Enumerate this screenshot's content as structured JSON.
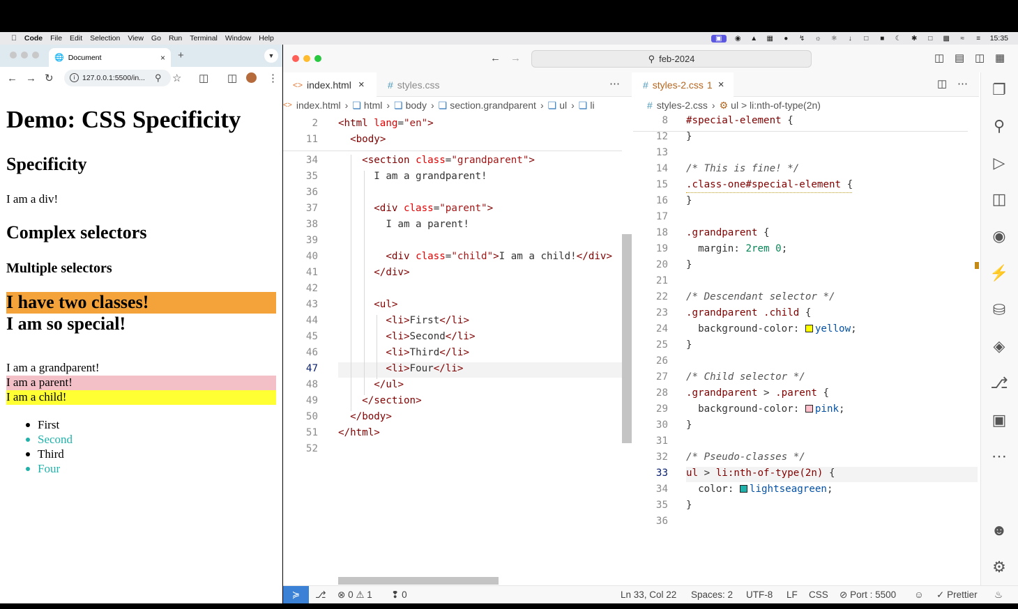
{
  "menubar": {
    "app": "Code",
    "items": [
      "File",
      "Edit",
      "Selection",
      "View",
      "Go",
      "Run",
      "Terminal",
      "Window",
      "Help"
    ],
    "clock": "15:35"
  },
  "browser": {
    "tab_title": "Document",
    "url": "127.0.0.1:5500/in...",
    "content": {
      "h1": "Demo: CSS Specificity",
      "h2_specificity": "Specificity",
      "div_text": "I am a div!",
      "h2_complex": "Complex selectors",
      "h3_multiple": "Multiple selectors",
      "two_classes": "I have two classes!",
      "special": "I am so special!",
      "grandparent": "I am a grandparent!",
      "parent": "I am a parent!",
      "child": "I am a child!",
      "list": [
        "First",
        "Second",
        "Third",
        "Four"
      ]
    },
    "colors": {
      "two_classes_bg": "#f4a23a",
      "parent_bg": "#f4c0c8",
      "child_bg": "#ffff33",
      "seagreen": "#20b2aa"
    }
  },
  "vscode": {
    "search": "feb-2024",
    "left_editor": {
      "tabs": [
        {
          "label": "index.html",
          "active": true
        },
        {
          "label": "styles.css",
          "active": false
        }
      ],
      "breadcrumb": [
        "index.html",
        "html",
        "body",
        "section.grandparent",
        "ul",
        "li"
      ],
      "sticky": [
        {
          "n": "2",
          "code": "<html lang=\"en\">"
        },
        {
          "n": "11",
          "code": "  <body>"
        }
      ],
      "lines": [
        {
          "n": "34",
          "code": "    <section class=\"grandparent\">"
        },
        {
          "n": "35",
          "code": "      I am a grandparent!"
        },
        {
          "n": "36",
          "code": ""
        },
        {
          "n": "37",
          "code": "      <div class=\"parent\">"
        },
        {
          "n": "38",
          "code": "        I am a parent!"
        },
        {
          "n": "39",
          "code": ""
        },
        {
          "n": "40",
          "code": "        <div class=\"child\">I am a child!</div>"
        },
        {
          "n": "41",
          "code": "      </div>"
        },
        {
          "n": "42",
          "code": ""
        },
        {
          "n": "43",
          "code": "      <ul>"
        },
        {
          "n": "44",
          "code": "        <li>First</li>"
        },
        {
          "n": "45",
          "code": "        <li>Second</li>"
        },
        {
          "n": "46",
          "code": "        <li>Third</li>"
        },
        {
          "n": "47",
          "code": "        <li>Four</li>"
        },
        {
          "n": "48",
          "code": "      </ul>"
        },
        {
          "n": "49",
          "code": "    </section>"
        },
        {
          "n": "50",
          "code": "  </body>"
        },
        {
          "n": "51",
          "code": "</html>"
        },
        {
          "n": "52",
          "code": ""
        }
      ]
    },
    "right_editor": {
      "tab": {
        "label": "styles-2.css",
        "badge": "1"
      },
      "breadcrumb": [
        "styles-2.css",
        "ul > li:nth-of-type(2n)"
      ],
      "sticky": {
        "n": "8",
        "code": "#special-element {"
      },
      "lines": [
        {
          "n": "12",
          "code": "}"
        },
        {
          "n": "13",
          "code": ""
        },
        {
          "n": "14",
          "code": "/* This is fine! */"
        },
        {
          "n": "15",
          "code": ".class-one#special-element {"
        },
        {
          "n": "16",
          "code": "}"
        },
        {
          "n": "17",
          "code": ""
        },
        {
          "n": "18",
          "code": ".grandparent {"
        },
        {
          "n": "19",
          "code": "  margin: 2rem 0;"
        },
        {
          "n": "20",
          "code": "}"
        },
        {
          "n": "21",
          "code": ""
        },
        {
          "n": "22",
          "code": "/* Descendant selector */"
        },
        {
          "n": "23",
          "code": ".grandparent .child {"
        },
        {
          "n": "24",
          "code": "  background-color: yellow;"
        },
        {
          "n": "25",
          "code": "}"
        },
        {
          "n": "26",
          "code": ""
        },
        {
          "n": "27",
          "code": "/* Child selector */"
        },
        {
          "n": "28",
          "code": ".grandparent > .parent {"
        },
        {
          "n": "29",
          "code": "  background-color: pink;"
        },
        {
          "n": "30",
          "code": "}"
        },
        {
          "n": "31",
          "code": ""
        },
        {
          "n": "32",
          "code": "/* Pseudo-classes */"
        },
        {
          "n": "33",
          "code": "ul > li:nth-of-type(2n) {"
        },
        {
          "n": "34",
          "code": "  color: lightseagreen;"
        },
        {
          "n": "35",
          "code": "}"
        },
        {
          "n": "36",
          "code": ""
        }
      ]
    },
    "status": {
      "position": "Ln 33, Col 22",
      "spaces": "Spaces: 2",
      "encoding": "UTF-8",
      "eol": "LF",
      "language": "CSS",
      "port": "Port : 5500",
      "formatter": "Prettier",
      "errors": "0",
      "warnings": "1",
      "ports": "0"
    }
  }
}
